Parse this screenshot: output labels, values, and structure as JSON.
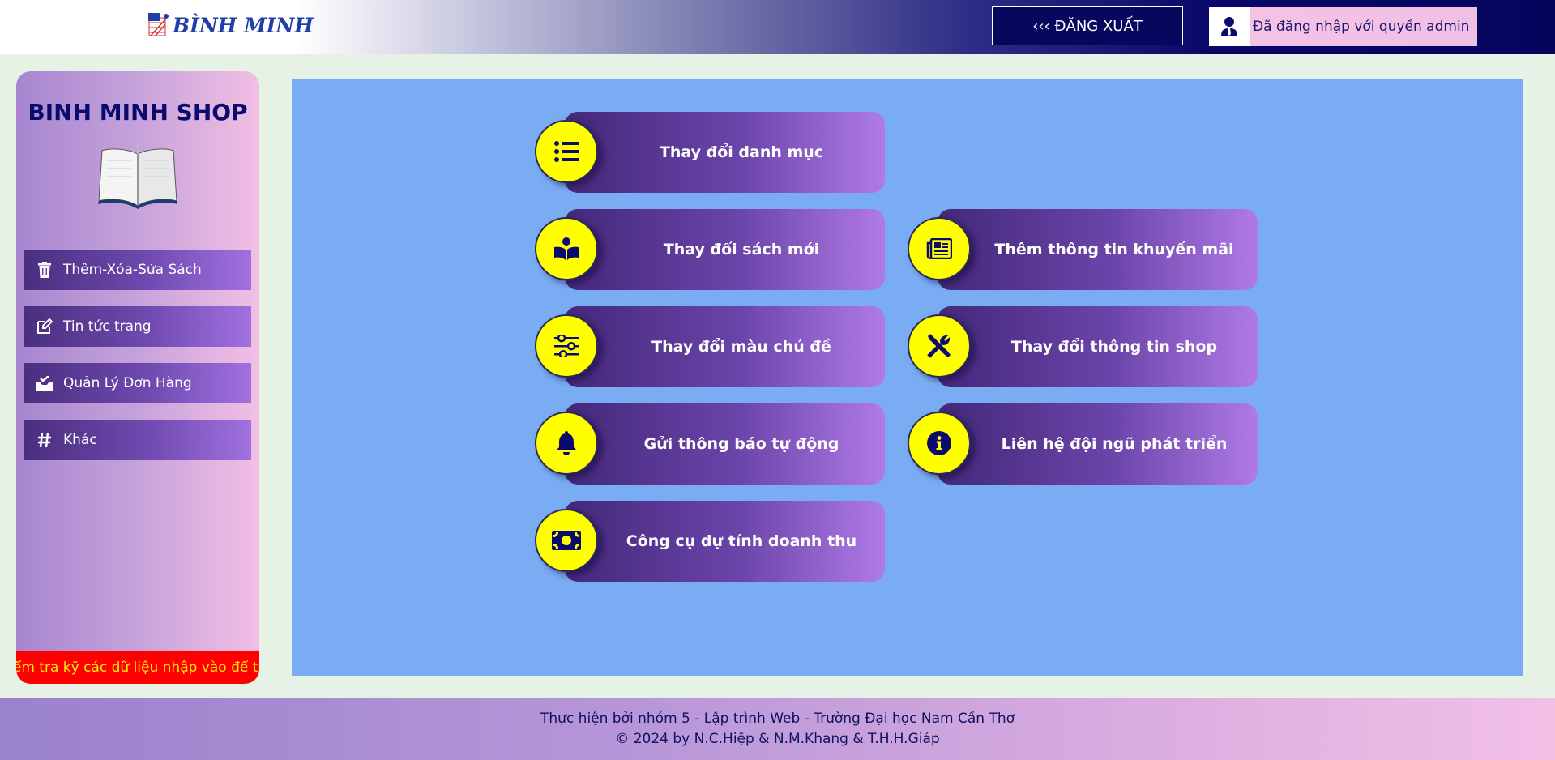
{
  "header": {
    "logo_text": "BÌNH MINH",
    "logout_label": "‹‹‹ ĐĂNG XUẤT",
    "admin_text": "Đã đăng nhập với quyền admin"
  },
  "sidebar": {
    "title": "BINH MINH SHOP",
    "items": [
      {
        "label": "Thêm-Xóa-Sửa Sách",
        "icon": "trash-icon"
      },
      {
        "label": "Tin tức trang",
        "icon": "edit-icon"
      },
      {
        "label": "Quản Lý Đơn Hàng",
        "icon": "inbox-check-icon"
      },
      {
        "label": "Khác",
        "icon": "hashtag-icon"
      }
    ],
    "marquee_text": "Kiểm tra kỹ các dữ liệu nhập vào để tránh sai sót"
  },
  "cards": [
    {
      "label": "Thay đổi danh mục",
      "icon": "list-icon"
    },
    {
      "label": "Thay đổi sách mới",
      "icon": "book-reader-icon"
    },
    {
      "label": "Thêm thông tin khuyến mãi",
      "icon": "newspaper-icon"
    },
    {
      "label": "Thay đổi màu chủ đề",
      "icon": "sliders-icon"
    },
    {
      "label": "Thay đổi thông tin shop",
      "icon": "tools-icon"
    },
    {
      "label": "Gửi thông báo tự động",
      "icon": "bell-icon"
    },
    {
      "label": "Liên hệ đội ngũ phát triển",
      "icon": "info-circle-icon"
    },
    {
      "label": "Công cụ dự tính doanh thu",
      "icon": "money-bill-icon"
    }
  ],
  "footer": {
    "line1": "Thực hiện bởi nhóm 5 - Lập trình Web - Trường Đại học Nam Cần Thơ",
    "line2": "© 2024 by N.C.Hiệp & N.M.Khang & T.H.H.Giáp"
  },
  "colors": {
    "header_dark": "#05055c",
    "main_panel": "#7aacf4",
    "card_icon_bg": "#ffff00",
    "marquee_bg": "#ff0000",
    "marquee_text": "#ffee00"
  }
}
